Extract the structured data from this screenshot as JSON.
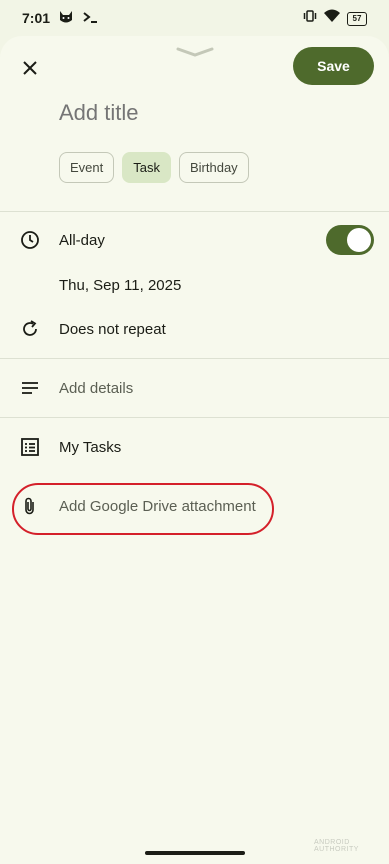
{
  "status_bar": {
    "time": "7:01",
    "battery": "57",
    "left_icons": [
      "cat-app-icon",
      "terminal-icon"
    ],
    "right_icons": [
      "vibrate-icon",
      "wifi-icon",
      "battery-icon"
    ]
  },
  "header": {
    "save_label": "Save",
    "title_placeholder": "Add title"
  },
  "chips": [
    {
      "label": "Event",
      "selected": false
    },
    {
      "label": "Task",
      "selected": true
    },
    {
      "label": "Birthday",
      "selected": false
    }
  ],
  "rows": {
    "all_day": {
      "label": "All-day",
      "toggle_on": true
    },
    "date": {
      "label": "Thu, Sep 11, 2025"
    },
    "repeat": {
      "label": "Does not repeat"
    },
    "details": {
      "label": "Add details"
    },
    "task_list": {
      "label": "My Tasks"
    },
    "attachment": {
      "label": "Add Google Drive attachment"
    }
  },
  "colors": {
    "accent": "#4e6a2c",
    "chip_selected": "#d9e7c5",
    "background": "#f7f9ed",
    "highlight": "#d4202a"
  },
  "watermark": "ANDROID AUTHORITY"
}
